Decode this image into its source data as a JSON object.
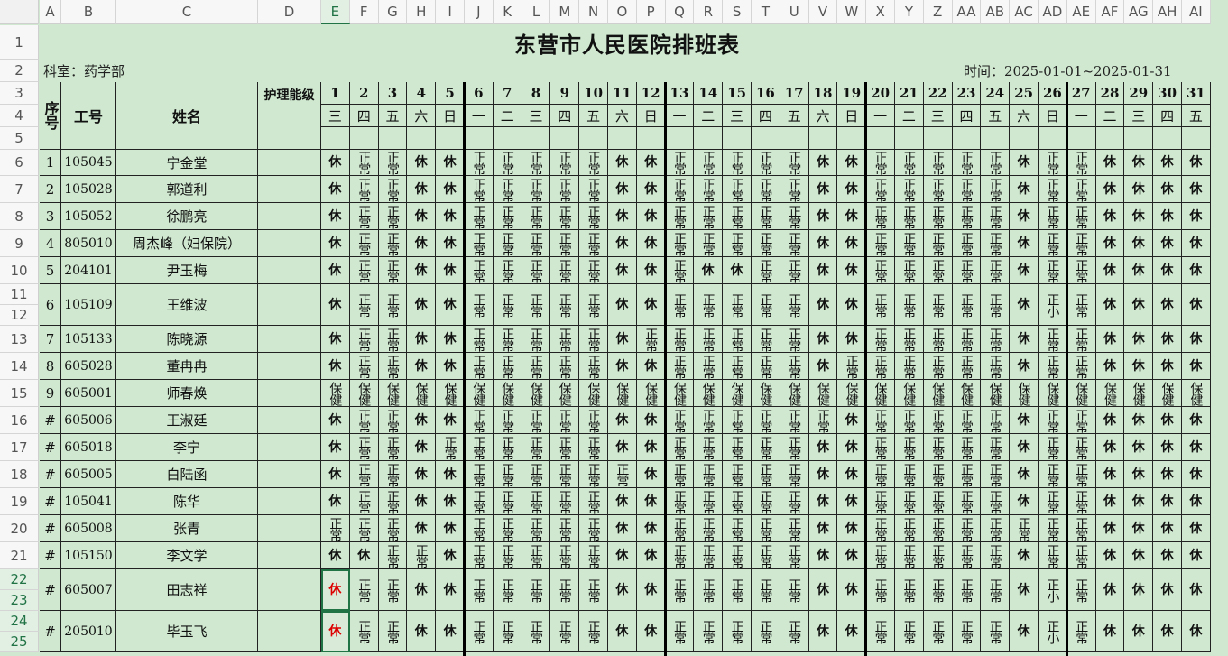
{
  "sheet": {
    "title": "东营市人民医院排班表",
    "department": "科室：药学部",
    "period": "时间：2025-01-01~2025-01-31",
    "headers": {
      "seq": "序号",
      "id": "工号",
      "name": "姓名",
      "level": "护理能级"
    },
    "columns": [
      "A",
      "B",
      "C",
      "D",
      "E",
      "F",
      "G",
      "H",
      "I",
      "J",
      "K",
      "L",
      "M",
      "N",
      "O",
      "P",
      "Q",
      "R",
      "S",
      "T",
      "U",
      "V",
      "W",
      "X",
      "Y",
      "Z",
      "AA",
      "AB",
      "AC",
      "AD",
      "AE",
      "AF",
      "AG",
      "AH",
      "AI"
    ],
    "selected_column": "E",
    "row_numbers": [
      "1",
      "2",
      "3",
      "4",
      "5",
      "6",
      "7",
      "8",
      "9",
      "10",
      "11",
      "12",
      "13",
      "14",
      "15",
      "16",
      "17",
      "18",
      "19",
      "20",
      "21",
      "22",
      "23",
      "24",
      "25"
    ],
    "days": [
      "1",
      "2",
      "3",
      "4",
      "5",
      "6",
      "7",
      "8",
      "9",
      "10",
      "11",
      "12",
      "13",
      "14",
      "15",
      "16",
      "17",
      "18",
      "19",
      "20",
      "21",
      "22",
      "23",
      "24",
      "25",
      "26",
      "27",
      "28",
      "29",
      "30",
      "31"
    ],
    "weekdays": [
      "三",
      "四",
      "五",
      "六",
      "日",
      "一",
      "二",
      "三",
      "四",
      "五",
      "六",
      "日",
      "一",
      "二",
      "三",
      "四",
      "五",
      "六",
      "日",
      "一",
      "二",
      "三",
      "四",
      "五",
      "六",
      "日",
      "一",
      "二",
      "三",
      "四",
      "五"
    ],
    "staff": [
      {
        "seq": "1",
        "id": "105045",
        "name": "宁金堂",
        "shifts": [
          "休",
          "正常",
          "正常",
          "休",
          "休",
          "正常",
          "正常",
          "正常",
          "正常",
          "正常",
          "休",
          "休",
          "正常",
          "正常",
          "正常",
          "正常",
          "正常",
          "休",
          "休",
          "正常",
          "正常",
          "正常",
          "正常",
          "正常",
          "休",
          "正常",
          "正常",
          "休",
          "休",
          "休",
          "休"
        ]
      },
      {
        "seq": "2",
        "id": "105028",
        "name": "郭道利",
        "shifts": [
          "休",
          "正常",
          "正常",
          "休",
          "休",
          "正常",
          "正常",
          "正常",
          "正常",
          "正常",
          "休",
          "休",
          "正常",
          "正常",
          "正常",
          "正常",
          "正常",
          "休",
          "休",
          "正常",
          "正常",
          "正常",
          "正常",
          "正常",
          "休",
          "正常",
          "正常",
          "休",
          "休",
          "休",
          "休"
        ]
      },
      {
        "seq": "3",
        "id": "105052",
        "name": "徐鹏亮",
        "shifts": [
          "休",
          "正常",
          "正常",
          "休",
          "休",
          "正常",
          "正常",
          "正常",
          "正常",
          "正常",
          "休",
          "休",
          "正常",
          "正常",
          "正常",
          "正常",
          "正常",
          "休",
          "休",
          "正常",
          "正常",
          "正常",
          "正常",
          "正常",
          "休",
          "正常",
          "正常",
          "休",
          "休",
          "休",
          "休"
        ]
      },
      {
        "seq": "4",
        "id": "805010",
        "name": "周杰峰（妇保院）",
        "shifts": [
          "休",
          "正常",
          "正常",
          "休",
          "休",
          "正常",
          "正常",
          "正常",
          "正常",
          "正常",
          "休",
          "休",
          "正常",
          "正常",
          "正常",
          "正常",
          "正常",
          "休",
          "休",
          "正常",
          "正常",
          "正常",
          "正常",
          "正常",
          "休",
          "正常",
          "正常",
          "休",
          "休",
          "休",
          "休"
        ]
      },
      {
        "seq": "5",
        "id": "204101",
        "name": "尹玉梅",
        "shifts": [
          "休",
          "正常",
          "正常",
          "休",
          "休",
          "正常",
          "正常",
          "正常",
          "正常",
          "正常",
          "休",
          "休",
          "正常",
          "休",
          "休",
          "正常",
          "正常",
          "休",
          "休",
          "正常",
          "正常",
          "正常",
          "正常",
          "正常",
          "休",
          "正常",
          "正常",
          "休",
          "休",
          "休",
          "休"
        ]
      },
      {
        "seq": "6",
        "id": "105109",
        "name": "王维波",
        "shifts": [
          "休",
          "正常",
          "正常",
          "休",
          "休",
          "正常",
          "正常",
          "正常",
          "正常",
          "正常",
          "休",
          "休",
          "正常",
          "正常",
          "正常",
          "正常",
          "正常",
          "休",
          "休",
          "正常",
          "正常",
          "正常",
          "正常",
          "正常",
          "休",
          "正小",
          "正常",
          "休",
          "休",
          "休",
          "休"
        ]
      },
      {
        "seq": "7",
        "id": "105133",
        "name": "陈晓源",
        "shifts": [
          "休",
          "正常",
          "正常",
          "休",
          "休",
          "正常",
          "正常",
          "正常",
          "正常",
          "正常",
          "休",
          "正常",
          "正常",
          "正常",
          "正常",
          "正常",
          "正常",
          "休",
          "休",
          "正常",
          "正常",
          "正常",
          "正常",
          "正常",
          "休",
          "正常",
          "正常",
          "休",
          "休",
          "休",
          "休"
        ]
      },
      {
        "seq": "8",
        "id": "605028",
        "name": "董冉冉",
        "shifts": [
          "休",
          "正常",
          "正常",
          "休",
          "休",
          "正常",
          "正常",
          "正常",
          "正常",
          "正常",
          "休",
          "休",
          "正常",
          "正常",
          "正常",
          "正常",
          "正常",
          "休",
          "正常",
          "正常",
          "正常",
          "正常",
          "正常",
          "正常",
          "休",
          "正常",
          "正常",
          "休",
          "休",
          "休",
          "休"
        ]
      },
      {
        "seq": "9",
        "id": "605001",
        "name": "师春焕",
        "shifts": [
          "保健",
          "保健",
          "保健",
          "保健",
          "保健",
          "保健",
          "保健",
          "保健",
          "保健",
          "保健",
          "保健",
          "保健",
          "保健",
          "保健",
          "保健",
          "保健",
          "保健",
          "保健",
          "保健",
          "保健",
          "保健",
          "保健",
          "保健",
          "保健",
          "保健",
          "保健",
          "保健",
          "保健",
          "保健",
          "保健",
          "保健"
        ]
      },
      {
        "seq": "#",
        "id": "605006",
        "name": "王淑廷",
        "shifts": [
          "休",
          "正常",
          "正常",
          "休",
          "休",
          "正常",
          "正常",
          "正常",
          "正常",
          "正常",
          "休",
          "休",
          "正常",
          "正常",
          "正常",
          "正常",
          "正常",
          "正常",
          "休",
          "正常",
          "正常",
          "正常",
          "正常",
          "正常",
          "休",
          "正常",
          "正常",
          "休",
          "休",
          "休",
          "休"
        ]
      },
      {
        "seq": "#",
        "id": "605018",
        "name": "李宁",
        "shifts": [
          "休",
          "正常",
          "正常",
          "休",
          "正常",
          "正常",
          "正常",
          "正常",
          "正常",
          "正常",
          "休",
          "休",
          "正常",
          "正常",
          "正常",
          "正常",
          "正常",
          "休",
          "休",
          "正常",
          "正常",
          "正常",
          "正常",
          "正常",
          "休",
          "正常",
          "正常",
          "休",
          "休",
          "休",
          "休"
        ]
      },
      {
        "seq": "#",
        "id": "605005",
        "name": "白陆函",
        "shifts": [
          "休",
          "正常",
          "正常",
          "休",
          "休",
          "正常",
          "正常",
          "正常",
          "正常",
          "正常",
          "正常",
          "休",
          "正常",
          "正常",
          "正常",
          "正常",
          "正常",
          "休",
          "休",
          "正常",
          "正常",
          "正常",
          "正常",
          "正常",
          "休",
          "正常",
          "正常",
          "休",
          "休",
          "休",
          "休"
        ]
      },
      {
        "seq": "#",
        "id": "105041",
        "name": "陈华",
        "shifts": [
          "休",
          "正常",
          "正常",
          "休",
          "休",
          "正常",
          "正常",
          "正常",
          "正常",
          "正常",
          "休",
          "休",
          "正常",
          "正常",
          "正常",
          "正常",
          "正常",
          "休",
          "休",
          "正常",
          "正常",
          "正常",
          "正常",
          "正常",
          "休",
          "正常",
          "正常",
          "休",
          "休",
          "休",
          "休"
        ]
      },
      {
        "seq": "#",
        "id": "605008",
        "name": "张青",
        "shifts": [
          "正常",
          "正常",
          "正常",
          "休",
          "休",
          "正常",
          "正常",
          "正常",
          "正常",
          "正常",
          "休",
          "休",
          "正常",
          "正常",
          "正常",
          "正常",
          "正常",
          "休",
          "休",
          "正常",
          "正常",
          "正常",
          "正常",
          "正常",
          "正常",
          "正常",
          "正常",
          "休",
          "休",
          "休",
          "休"
        ]
      },
      {
        "seq": "#",
        "id": "105150",
        "name": "李文学",
        "shifts": [
          "休",
          "休",
          "正常",
          "正常",
          "休",
          "正常",
          "正常",
          "正常",
          "正常",
          "正常",
          "休",
          "休",
          "正常",
          "正常",
          "正常",
          "正常",
          "正常",
          "休",
          "休",
          "正常",
          "正常",
          "正常",
          "正常",
          "正常",
          "休",
          "正常",
          "正常",
          "休",
          "休",
          "休",
          "休"
        ]
      },
      {
        "seq": "#",
        "id": "605007",
        "name": "田志祥",
        "shifts": [
          "休",
          "正常",
          "正常",
          "休",
          "休",
          "正常",
          "正常",
          "正常",
          "正常",
          "正常",
          "休",
          "休",
          "正常",
          "正常",
          "正常",
          "正常",
          "正常",
          "休",
          "休",
          "正常",
          "正常",
          "正常",
          "正常",
          "正常",
          "休",
          "正小",
          "正常",
          "休",
          "休",
          "休",
          "休"
        ]
      },
      {
        "seq": "#",
        "id": "205010",
        "name": "毕玉飞",
        "shifts": [
          "休",
          "正常",
          "正常",
          "休",
          "休",
          "正常",
          "正常",
          "正常",
          "正常",
          "正常",
          "休",
          "休",
          "正常",
          "正常",
          "正常",
          "正常",
          "正常",
          "休",
          "休",
          "正常",
          "正常",
          "正常",
          "正常",
          "正常",
          "休",
          "正小",
          "正常",
          "休",
          "休",
          "休",
          "休"
        ]
      }
    ]
  },
  "colors": {
    "background": "#cfe8cf",
    "selection": "#217346",
    "highlight_text": "#dd0000"
  }
}
